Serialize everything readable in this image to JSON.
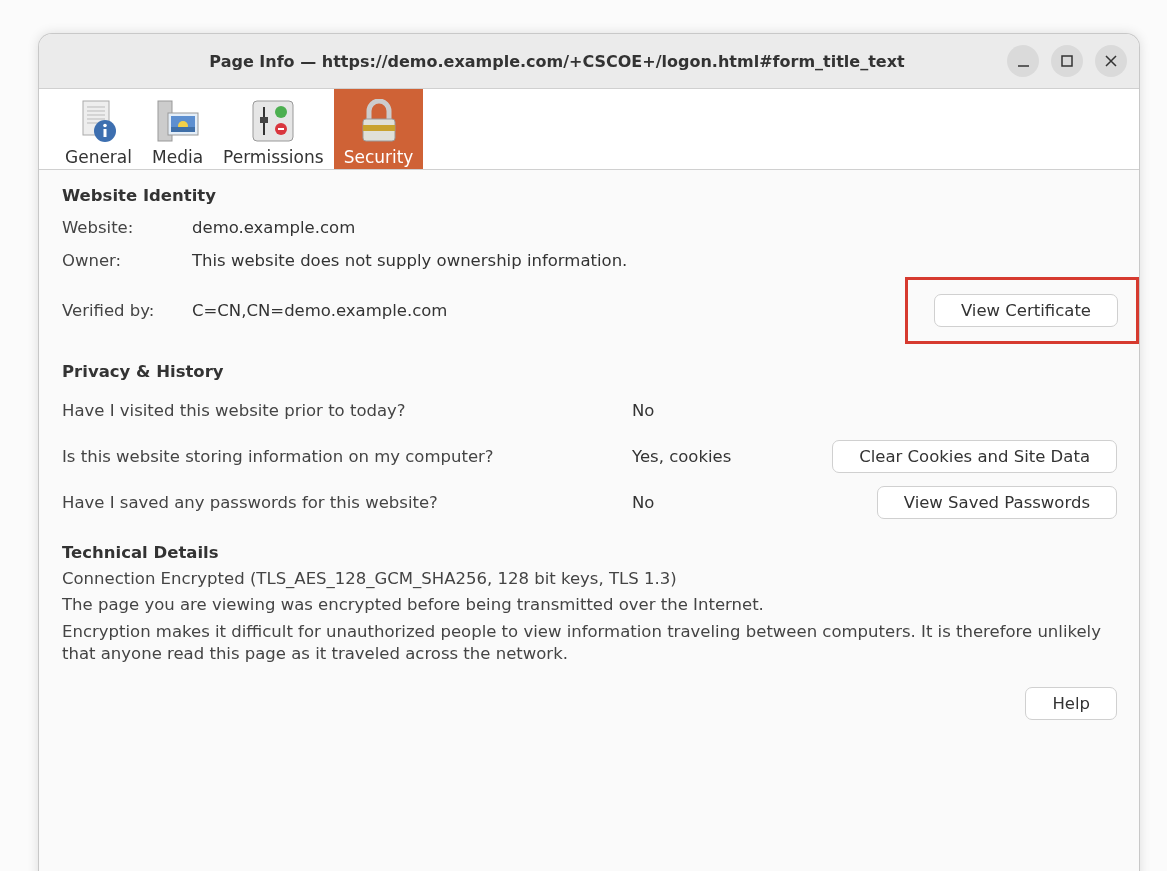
{
  "window": {
    "title": "Page Info — https://demo.example.com/+CSCOE+/logon.html#form_title_text",
    "controls": [
      {
        "kind": "minimize"
      },
      {
        "kind": "maximize"
      },
      {
        "kind": "close"
      }
    ]
  },
  "tabs": [
    {
      "label": "General",
      "kind": "general",
      "selected": false
    },
    {
      "label": "Media",
      "kind": "media",
      "selected": false
    },
    {
      "label": "Permissions",
      "kind": "permissions",
      "selected": false
    },
    {
      "label": "Security",
      "kind": "security",
      "selected": true
    }
  ],
  "website_identity": {
    "heading": "Website Identity",
    "rows": [
      {
        "label": "Website:",
        "value": "demo.example.com"
      },
      {
        "label": "Owner:",
        "value": "This website does not supply ownership information."
      },
      {
        "label": "Verified by:",
        "value": "C=CN,CN=demo.example.com",
        "button": {
          "label": "View Certificate",
          "highlighted": true
        }
      }
    ]
  },
  "privacy_history": {
    "heading": "Privacy & History",
    "rows": [
      {
        "question": "Have I visited this website prior to today?",
        "answer": "No"
      },
      {
        "question": "Is this website storing information on my computer?",
        "answer": "Yes, cookies",
        "button": {
          "label": "Clear Cookies and Site Data",
          "highlighted": false
        }
      },
      {
        "question": "Have I saved any passwords for this website?",
        "answer": "No",
        "button": {
          "label": "View Saved Passwords",
          "highlighted": false
        }
      }
    ]
  },
  "technical_details": {
    "heading": "Technical Details",
    "lines": [
      "Connection Encrypted (TLS_AES_128_GCM_SHA256, 128 bit keys, TLS 1.3)",
      "The page you are viewing was encrypted before being transmitted over the Internet.",
      "Encryption makes it difficult for unauthorized people to view information traveling between computers. It is therefore unlikely that anyone read this page as it traveled across the network."
    ]
  },
  "help_button": {
    "label": "Help",
    "highlighted": false
  }
}
